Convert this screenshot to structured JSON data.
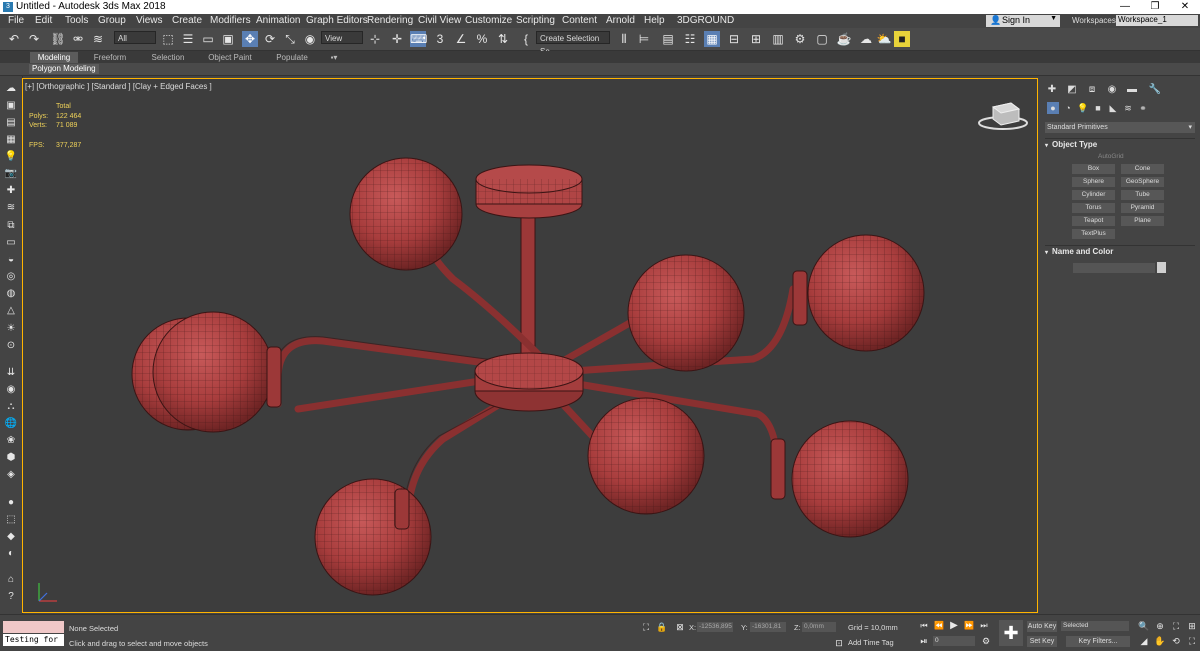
{
  "window": {
    "title": "Untitled - Autodesk 3ds Max 2018"
  },
  "menu": {
    "items": [
      "File",
      "Edit",
      "Tools",
      "Group",
      "Views",
      "Create",
      "Modifiers",
      "Animation",
      "Graph Editors",
      "Rendering",
      "Civil View",
      "Customize",
      "Scripting",
      "Content",
      "Arnold",
      "Help",
      "3DGROUND"
    ]
  },
  "account": {
    "signin_label": "Sign In",
    "workspaces_label": "Workspaces:",
    "workspace_value": "Workspace_1"
  },
  "toolbar": {
    "selection_filter": "All",
    "ref_coord": "View",
    "named_selection": "Create Selection Se"
  },
  "ribbon": {
    "tabs": [
      "Modeling",
      "Freeform",
      "Selection",
      "Object Paint",
      "Populate"
    ],
    "active_tab": "Modeling",
    "panel_label": "Polygon Modeling"
  },
  "viewport": {
    "label": "[+] [Orthographic ] [Standard ] [Clay + Edged Faces ]",
    "stats": {
      "total_label": "Total",
      "polys_label": "Polys:",
      "polys_value": "122 464",
      "verts_label": "Verts:",
      "verts_value": "71 089",
      "fps_label": "FPS:",
      "fps_value": "377,287"
    }
  },
  "command_panel": {
    "category": "Standard Primitives",
    "object_type_header": "Object Type",
    "autogrid_label": "AutoGrid",
    "buttons": [
      "Box",
      "Cone",
      "Sphere",
      "GeoSphere",
      "Cylinder",
      "Tube",
      "Torus",
      "Pyramid",
      "Teapot",
      "Plane",
      "TextPlus"
    ],
    "name_color_header": "Name and Color"
  },
  "status": {
    "script_listener": "Testing for :",
    "selection_text": "None Selected",
    "prompt_text": "Click and drag to select and move objects",
    "x_label": "X:",
    "x_value": "-12536,895",
    "y_label": "Y:",
    "y_value": "-16301,81",
    "z_label": "Z:",
    "z_value": "0,0mm",
    "grid_text": "Grid = 10,0mm",
    "add_time_tag": "Add Time Tag",
    "frame_value": "0",
    "auto_key": "Auto Key",
    "set_key": "Set Key",
    "selected_value": "Selected",
    "key_filters": "Key Filters..."
  },
  "colors": {
    "accent": "#5a7fb3",
    "viewport_border": "#ffb400",
    "model": "#b54545",
    "stats_text": "#f0d35a"
  }
}
